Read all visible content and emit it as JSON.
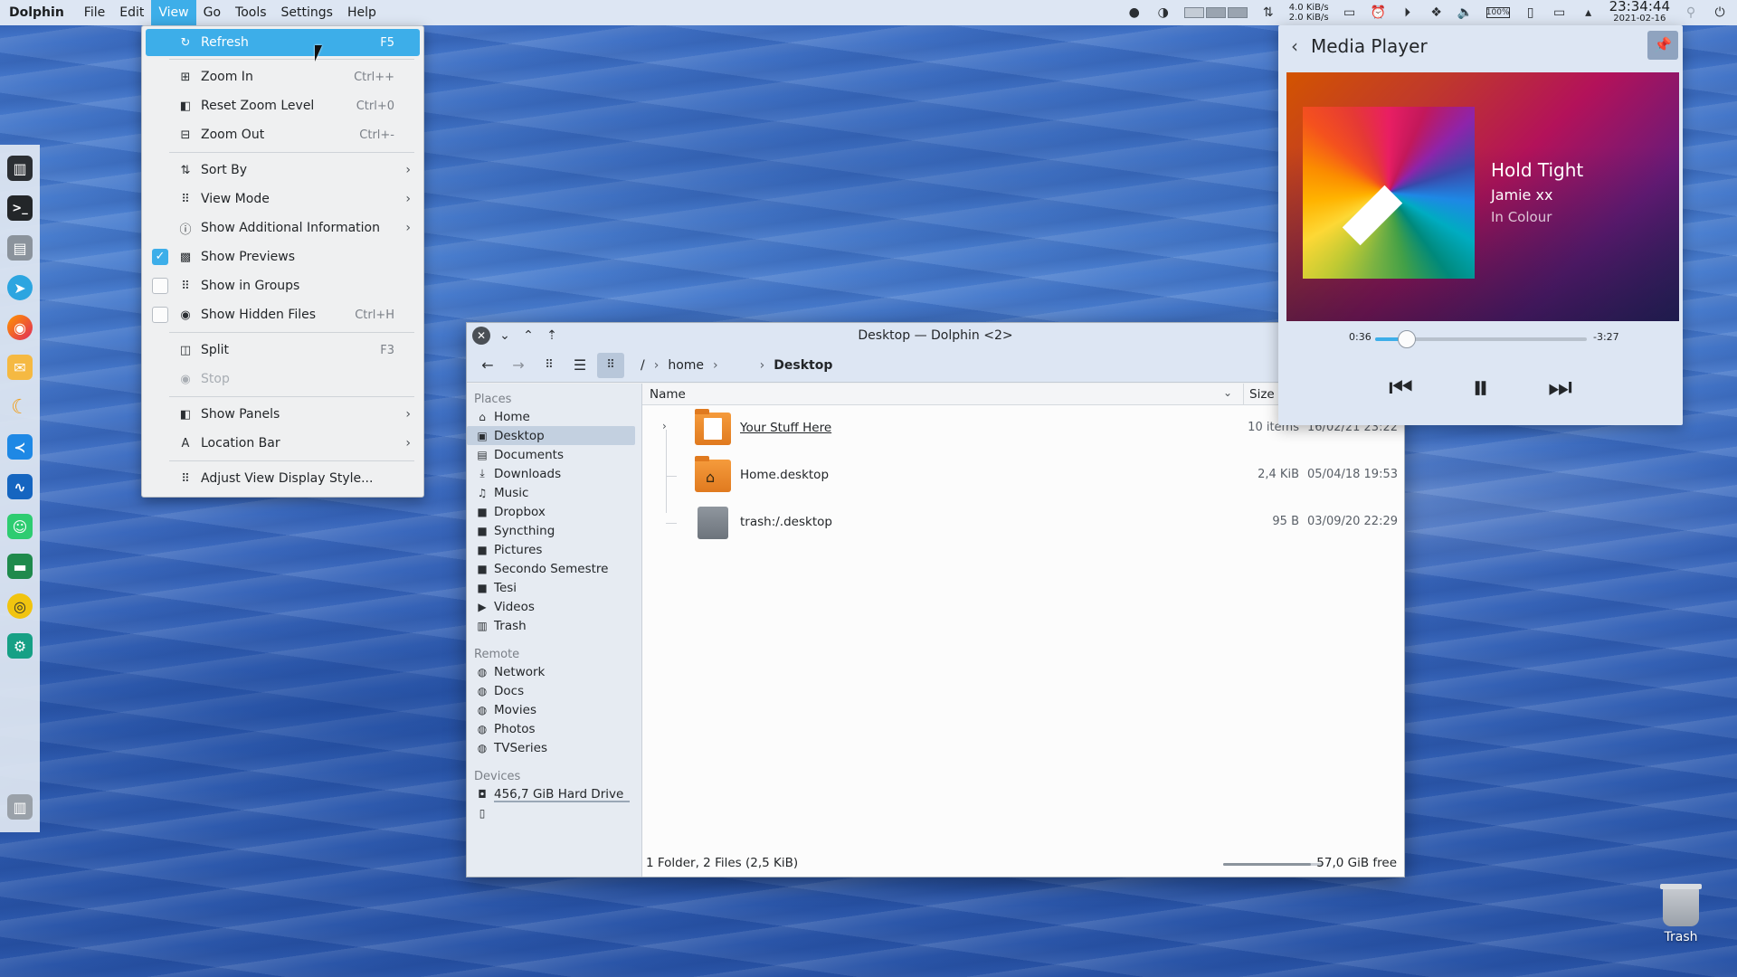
{
  "topbar": {
    "app_name": "Dolphin",
    "menus": [
      "File",
      "Edit",
      "View",
      "Go",
      "Tools",
      "Settings",
      "Help"
    ],
    "net_down": "4.0 KiB/s",
    "net_up": "2.0 KiB/s",
    "battery": "100%",
    "clock_time": "23:34:44",
    "clock_date": "2021-02-16"
  },
  "view_menu": {
    "items": [
      {
        "label": "Refresh",
        "shortcut": "F5",
        "icon": "refresh-icon"
      },
      {
        "label": "Zoom In",
        "shortcut": "Ctrl++",
        "icon": "zoom-in-icon"
      },
      {
        "label": "Reset Zoom Level",
        "shortcut": "Ctrl+0",
        "icon": "zoom-reset-icon"
      },
      {
        "label": "Zoom Out",
        "shortcut": "Ctrl+-",
        "icon": "zoom-out-icon"
      },
      {
        "label": "Sort By",
        "icon": "sort-icon"
      },
      {
        "label": "View Mode",
        "icon": "view-mode-icon"
      },
      {
        "label": "Show Additional Information",
        "icon": "info-icon"
      },
      {
        "label": "Show Previews",
        "icon": "image-icon",
        "checked": true
      },
      {
        "label": "Show in Groups",
        "icon": "grid-icon",
        "checked": false
      },
      {
        "label": "Show Hidden Files",
        "shortcut": "Ctrl+H",
        "icon": "eye-icon",
        "checked": false
      },
      {
        "label": "Split",
        "shortcut": "F3",
        "icon": "split-icon"
      },
      {
        "label": "Stop",
        "icon": "stop-icon",
        "disabled": true
      },
      {
        "label": "Show Panels",
        "icon": "panels-icon"
      },
      {
        "label": "Location Bar",
        "icon": "location-bar-icon"
      },
      {
        "label": "Adjust View Display Style...",
        "icon": "grid-icon"
      }
    ]
  },
  "media_player": {
    "title": "Media Player",
    "song": "Hold Tight",
    "artist": "Jamie xx",
    "album": "In Colour",
    "elapsed": "0:36",
    "remaining": "-3:27",
    "progress": 0.15
  },
  "dolphin": {
    "title": "Desktop — Dolphin <2>",
    "breadcrumb": {
      "root": "/",
      "home": "home",
      "current": "Desktop"
    },
    "places": {
      "groups": [
        {
          "name": "Places",
          "items": [
            "Home",
            "Desktop",
            "Documents",
            "Downloads",
            "Music",
            "Dropbox",
            "Syncthing",
            "Pictures",
            "Secondo Semestre",
            "Tesi",
            "Videos",
            "Trash"
          ]
        },
        {
          "name": "Remote",
          "items": [
            "Network",
            "Docs",
            "Movies",
            "Photos",
            "TVSeries"
          ]
        },
        {
          "name": "Devices",
          "items": [
            "456,7 GiB Hard Drive",
            ""
          ]
        }
      ]
    },
    "columns": {
      "name": "Name",
      "size": "Size"
    },
    "files": [
      {
        "name": "Your Stuff Here",
        "size": "10 items",
        "date": "16/02/21 23:22"
      },
      {
        "name": "Home.desktop",
        "size": "2,4 KiB",
        "date": "05/04/18 19:53"
      },
      {
        "name": "trash:/.desktop",
        "size": "95 B",
        "date": "03/09/20 22:29"
      }
    ],
    "status": "1 Folder, 2 Files (2,5 KiB)",
    "free_space": "57,0 GiB free",
    "used_fraction": 0.88
  },
  "desktop": {
    "trash_label": "Trash"
  }
}
